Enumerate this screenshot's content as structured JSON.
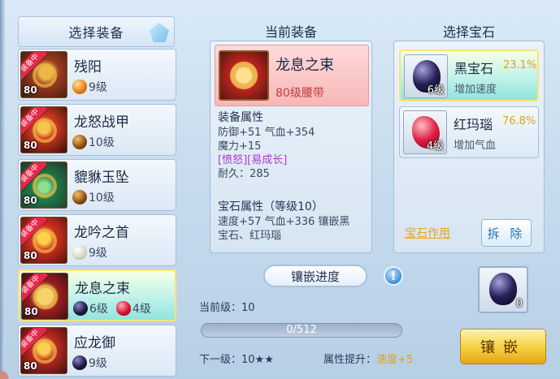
{
  "left": {
    "title": "选择装备",
    "equip_badge": "装备中",
    "items": [
      {
        "name": "残阳",
        "level_tag": "80",
        "gems": [
          {
            "icon": "orange-gem-icon",
            "text": "9级"
          }
        ],
        "thumb": "t0",
        "active": false
      },
      {
        "name": "龙怒战甲",
        "level_tag": "80",
        "gems": [
          {
            "icon": "brown-gem-icon",
            "text": "10级"
          }
        ],
        "thumb": "t1",
        "active": false
      },
      {
        "name": "貔貅玉坠",
        "level_tag": "80",
        "gems": [
          {
            "icon": "brown-gem-icon",
            "text": "10级"
          }
        ],
        "thumb": "t2",
        "active": false
      },
      {
        "name": "龙吟之首",
        "level_tag": "80",
        "gems": [
          {
            "icon": "pearl-gem-icon",
            "text": "9级"
          }
        ],
        "thumb": "t3",
        "active": false
      },
      {
        "name": "龙息之束",
        "level_tag": "80",
        "gems": [
          {
            "icon": "black-gem-icon",
            "text": "6级"
          },
          {
            "icon": "red-gem-icon",
            "text": "4级"
          }
        ],
        "thumb": "t4",
        "active": true
      },
      {
        "name": "应龙御",
        "level_tag": "80",
        "gems": [
          {
            "icon": "black-gem-icon",
            "text": "9级"
          }
        ],
        "thumb": "t5",
        "active": false
      }
    ]
  },
  "current": {
    "title": "当前装备",
    "name": "龙息之束",
    "type": "80级腰带",
    "attr_head": "装备属性",
    "attr_lines": [
      "防御+51 气血+354",
      "魔力+15"
    ],
    "special": "[愤怒][易成长]",
    "durability": "耐久：285",
    "gem_head": "宝石属性（等级10）",
    "gem_lines": [
      "速度+57 气血+336 镶嵌黑",
      "宝石、红玛瑙"
    ]
  },
  "gems": {
    "title": "选择宝石",
    "list": [
      {
        "name": "黑宝石",
        "rate": "23.1%",
        "desc": "增加速度",
        "count": "6级",
        "icon": "black-gem-icon",
        "active": true
      },
      {
        "name": "红玛瑙",
        "rate": "76.8%",
        "desc": "增加气血",
        "count": "4级",
        "icon": "red-gem-icon",
        "active": false
      }
    ],
    "func_link": "宝石作用",
    "remove_label": "拆 除"
  },
  "inlay": {
    "title": "镶嵌进度",
    "info_icon": "!",
    "current_level": "当前级：10",
    "progress_text": "0/512",
    "progress_fraction": 0,
    "next_level": "下一级：10★★",
    "stat_label": "属性提升：",
    "stat_value": "速度+5",
    "slot_count": "0",
    "button_label": "镶嵌"
  }
}
